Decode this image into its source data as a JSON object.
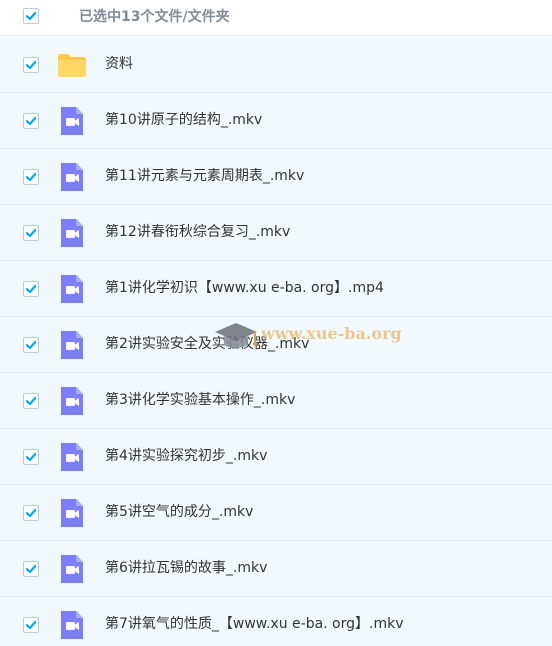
{
  "header": {
    "summary": "已选中13个文件/文件夹"
  },
  "items": [
    {
      "name": "资料",
      "type": "folder"
    },
    {
      "name": "第10讲原子的结构_.mkv",
      "type": "video"
    },
    {
      "name": "第11讲元素与元素周期表_.mkv",
      "type": "video"
    },
    {
      "name": "第12讲春衔秋综合复习_.mkv",
      "type": "video"
    },
    {
      "name": "第1讲化学初识【www.xu e-ba. org】.mp4",
      "type": "video"
    },
    {
      "name": "第2讲实验安全及实验仪器_.mkv",
      "type": "video"
    },
    {
      "name": "第3讲化学实验基本操作_.mkv",
      "type": "video"
    },
    {
      "name": "第4讲实验探究初步_.mkv",
      "type": "video"
    },
    {
      "name": "第5讲空气的成分_.mkv",
      "type": "video"
    },
    {
      "name": "第6讲拉瓦锡的故事_.mkv",
      "type": "video"
    },
    {
      "name": "第7讲氧气的性质_【www.xu e-ba. org】.mkv",
      "type": "video"
    }
  ],
  "watermark": {
    "text": "www.xue-ba.org",
    "icon": "graduation-cap-icon"
  },
  "colors": {
    "check": "#06a7ff",
    "folder": "#ffc84a",
    "video": "#7b7ff5",
    "row_bg": "#f1f9fe"
  }
}
